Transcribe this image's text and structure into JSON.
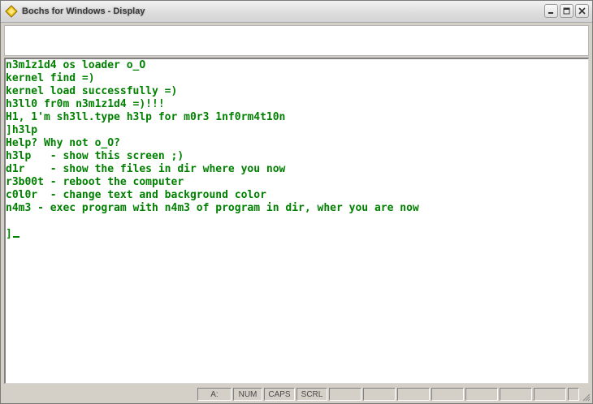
{
  "window": {
    "title": "Bochs for Windows - Display"
  },
  "console": {
    "lines": [
      "n3m1z1d4 os loader o_O",
      "kernel find =)",
      "kernel load successfully =)",
      "h3ll0 fr0m n3m1z1d4 =)!!!",
      "H1, 1'm sh3ll.type h3lp for m0r3 1nf0rm4t10n",
      "]h3lp",
      "Help? Why not o_O?",
      "h3lp   - show this screen ;)",
      "d1r    - show the files in dir where you now",
      "r3b00t - reboot the computer",
      "c0l0r  - change text and background color",
      "n4m3 - exec program with n4m3 of program in dir, wher you are now",
      "",
      "]"
    ],
    "text_color": "#008000",
    "background_color": "#ffffff"
  },
  "statusbar": {
    "drive": "A:",
    "num": "NUM",
    "caps": "CAPS",
    "scrl": "SCRL"
  },
  "icons": {
    "app": "bochs-app-icon",
    "minimize": "minimize-icon",
    "maximize": "maximize-icon",
    "close": "close-icon"
  }
}
